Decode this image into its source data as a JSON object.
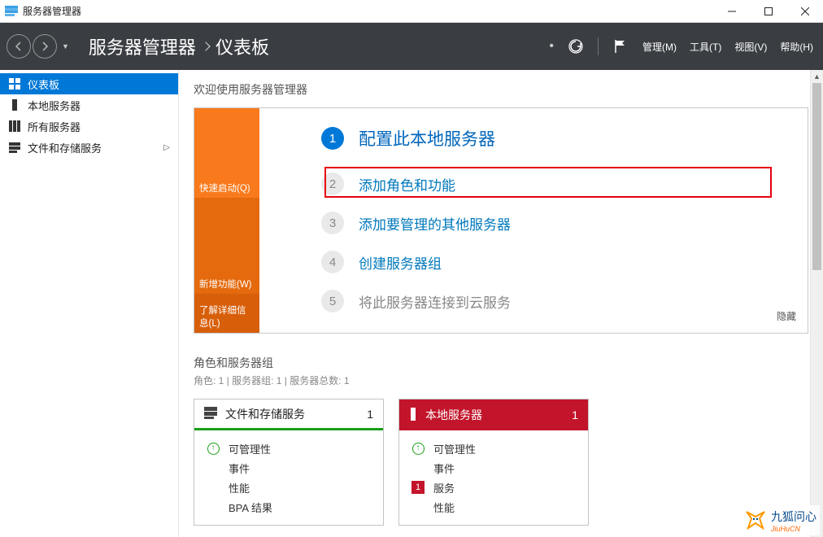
{
  "window": {
    "title": "服务器管理器"
  },
  "header": {
    "breadcrumb_app": "服务器管理器",
    "breadcrumb_page": "仪表板",
    "menu": {
      "manage": "管理(M)",
      "tools": "工具(T)",
      "view": "视图(V)",
      "help": "帮助(H)"
    }
  },
  "sidebar": {
    "items": [
      {
        "label": "仪表板",
        "icon": "dashboard"
      },
      {
        "label": "本地服务器",
        "icon": "local-server"
      },
      {
        "label": "所有服务器",
        "icon": "all-servers"
      },
      {
        "label": "文件和存储服务",
        "icon": "storage",
        "expandable": true
      }
    ]
  },
  "welcome": {
    "title": "欢迎使用服务器管理器",
    "left": {
      "quick": "快速启动(Q)",
      "new": "新增功能(W)",
      "learn": "了解详细信息(L)"
    },
    "steps": [
      {
        "num": "1",
        "text": "配置此本地服务器"
      },
      {
        "num": "2",
        "text": "添加角色和功能"
      },
      {
        "num": "3",
        "text": "添加要管理的其他服务器"
      },
      {
        "num": "4",
        "text": "创建服务器组"
      },
      {
        "num": "5",
        "text": "将此服务器连接到云服务"
      }
    ],
    "hide": "隐藏"
  },
  "section": {
    "title": "角色和服务器组",
    "sub": "角色: 1 | 服务器组: 1 | 服务器总数: 1"
  },
  "tiles": [
    {
      "kind": "green",
      "title": "文件和存储服务",
      "count": "1",
      "rows": [
        {
          "icon": "arrow-up",
          "label": "可管理性"
        },
        {
          "icon": "",
          "label": "事件"
        },
        {
          "icon": "",
          "label": "性能"
        },
        {
          "icon": "",
          "label": "BPA 结果"
        }
      ]
    },
    {
      "kind": "red",
      "title": "本地服务器",
      "count": "1",
      "rows": [
        {
          "icon": "arrow-up",
          "label": "可管理性"
        },
        {
          "icon": "",
          "label": "事件"
        },
        {
          "icon": "badge",
          "badge": "1",
          "label": "服务"
        },
        {
          "icon": "",
          "label": "性能"
        }
      ]
    }
  ],
  "watermark": {
    "cn": "九狐问心",
    "en": "JiuHuCN"
  }
}
